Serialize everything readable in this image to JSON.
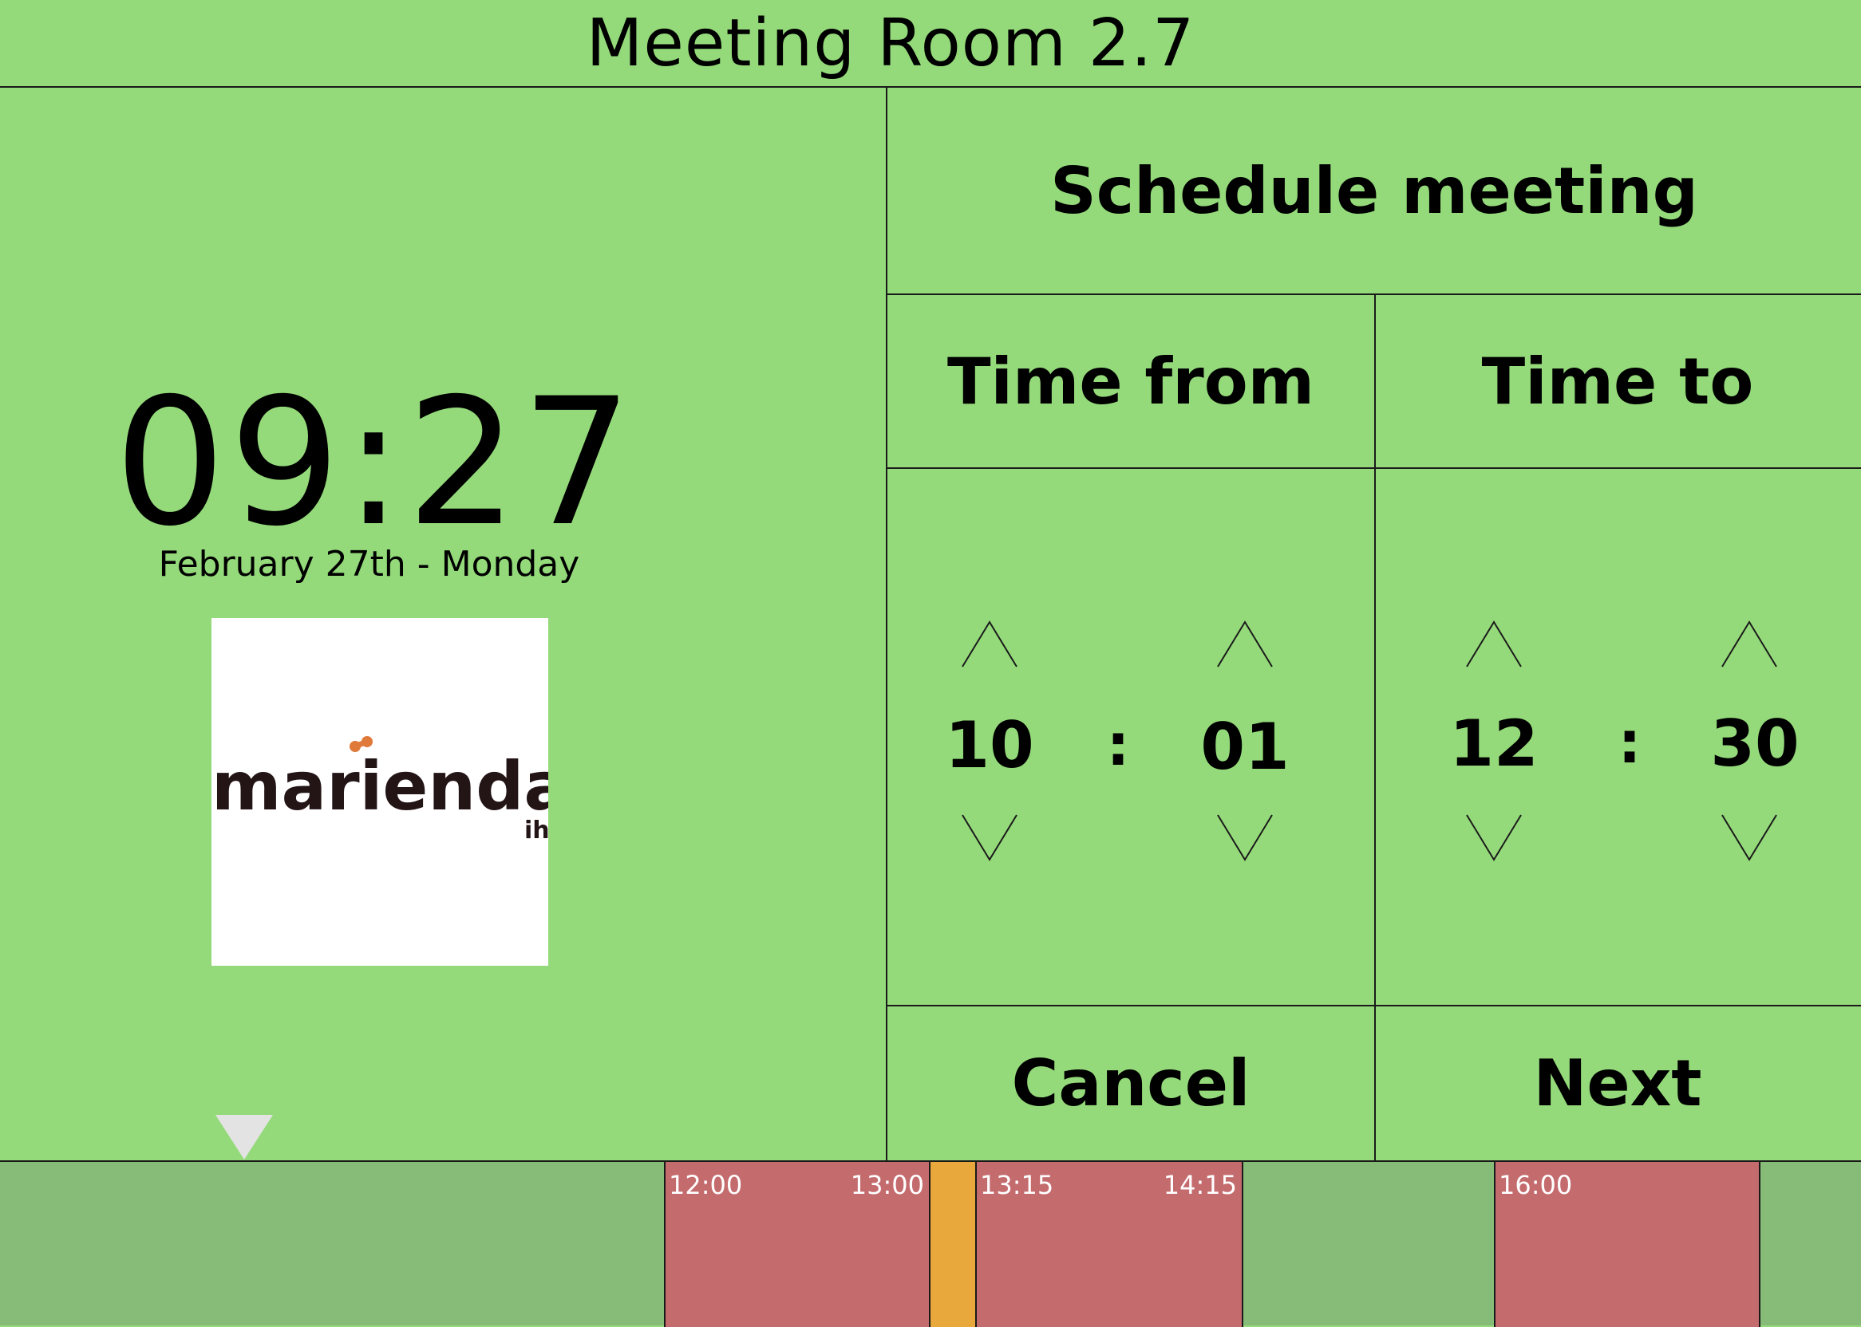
{
  "header": {
    "room_name": "Meeting Room 2.7"
  },
  "clock": {
    "time": "09:27",
    "date": "February 27th - Monday"
  },
  "logo": {
    "brand": "mariendal",
    "sub": "ih"
  },
  "schedule": {
    "title": "Schedule meeting",
    "from_label": "Time from",
    "to_label": "Time to",
    "from_hour": "10",
    "from_minute": "01",
    "to_hour": "12",
    "to_minute": "30",
    "separator": ":",
    "cancel_label": "Cancel",
    "next_label": "Next"
  },
  "timeline": {
    "bookings": [
      {
        "start_label": "12:00",
        "end_label": "13:00",
        "status": "booked"
      },
      {
        "start_label": "",
        "end_label": "",
        "status": "pending"
      },
      {
        "start_label": "13:15",
        "end_label": "14:15",
        "status": "booked"
      },
      {
        "start_label": "16:00",
        "end_label": "",
        "status": "booked"
      }
    ]
  },
  "colors": {
    "background": "#94da7a",
    "timeline_free": "#86bc77",
    "booked": "#c46b6e",
    "pending": "#e8a83b",
    "logo_accent": "#e07a3a"
  },
  "icons": {
    "up": "chevron-up-icon",
    "down": "chevron-down-icon",
    "now": "current-time-marker-icon"
  }
}
